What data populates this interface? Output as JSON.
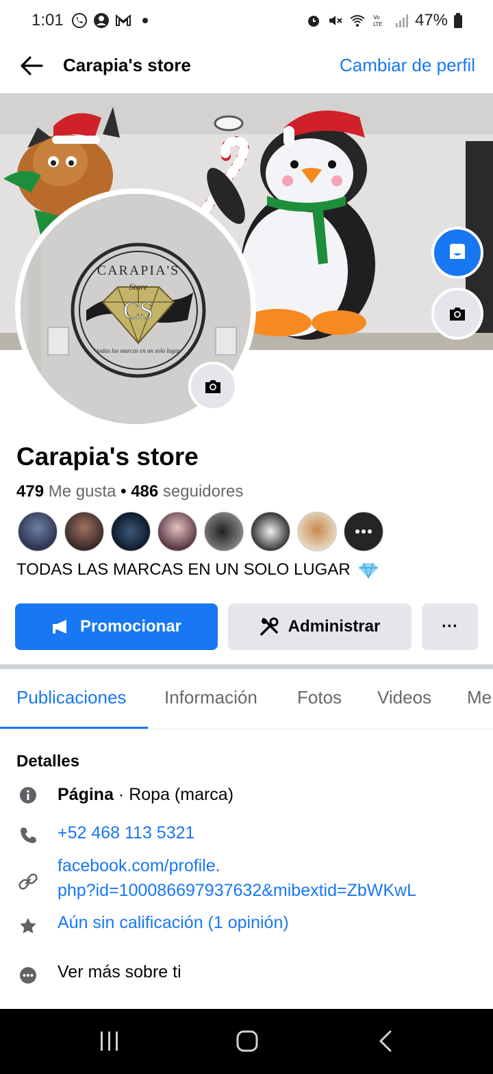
{
  "status": {
    "time": "1:01",
    "battery": "47%",
    "left_icons": [
      "whatsapp-icon",
      "account-circle-icon",
      "gmail-icon",
      "dot-icon"
    ],
    "right_icons": [
      "alarm-icon",
      "mute-icon",
      "wifi-icon",
      "volte-icon",
      "signal-icon",
      "battery-icon"
    ]
  },
  "header": {
    "title": "Carapia's store",
    "switch_profile": "Cambiar de perfil"
  },
  "profile": {
    "name": "Carapia's store",
    "likes_count": "479",
    "likes_label": "Me gusta",
    "separator": "•",
    "followers_count": "486",
    "followers_label": "seguidores",
    "bio": "TODAS LAS MARCAS EN UN SOLO LUGAR",
    "logo": {
      "top_text": "CARAPIA'S",
      "sub_text": "Store",
      "monogram": "CS",
      "bottom_text": "todas las marcas en un solo lugar"
    },
    "friend_count_shown": 8
  },
  "actions": {
    "promote": "Promocionar",
    "admin": "Administrar",
    "more": "···"
  },
  "tabs": [
    "Publicaciones",
    "Información",
    "Fotos",
    "Videos",
    "Me"
  ],
  "details": {
    "title": "Detalles",
    "page_label": "Página",
    "page_category": " · Ropa (marca)",
    "phone": "+52 468 113 5321",
    "url_line1": "facebook.com/profile.",
    "url_line2": "php?id=100086697937632&mibextid=ZbWKwL",
    "rating": "Aún sin calificación (1 opinión)",
    "see_more": "Ver más sobre ti"
  },
  "colors": {
    "accent": "#1877f2",
    "secondary_button": "#e4e6eb",
    "muted_text": "#65676b"
  }
}
